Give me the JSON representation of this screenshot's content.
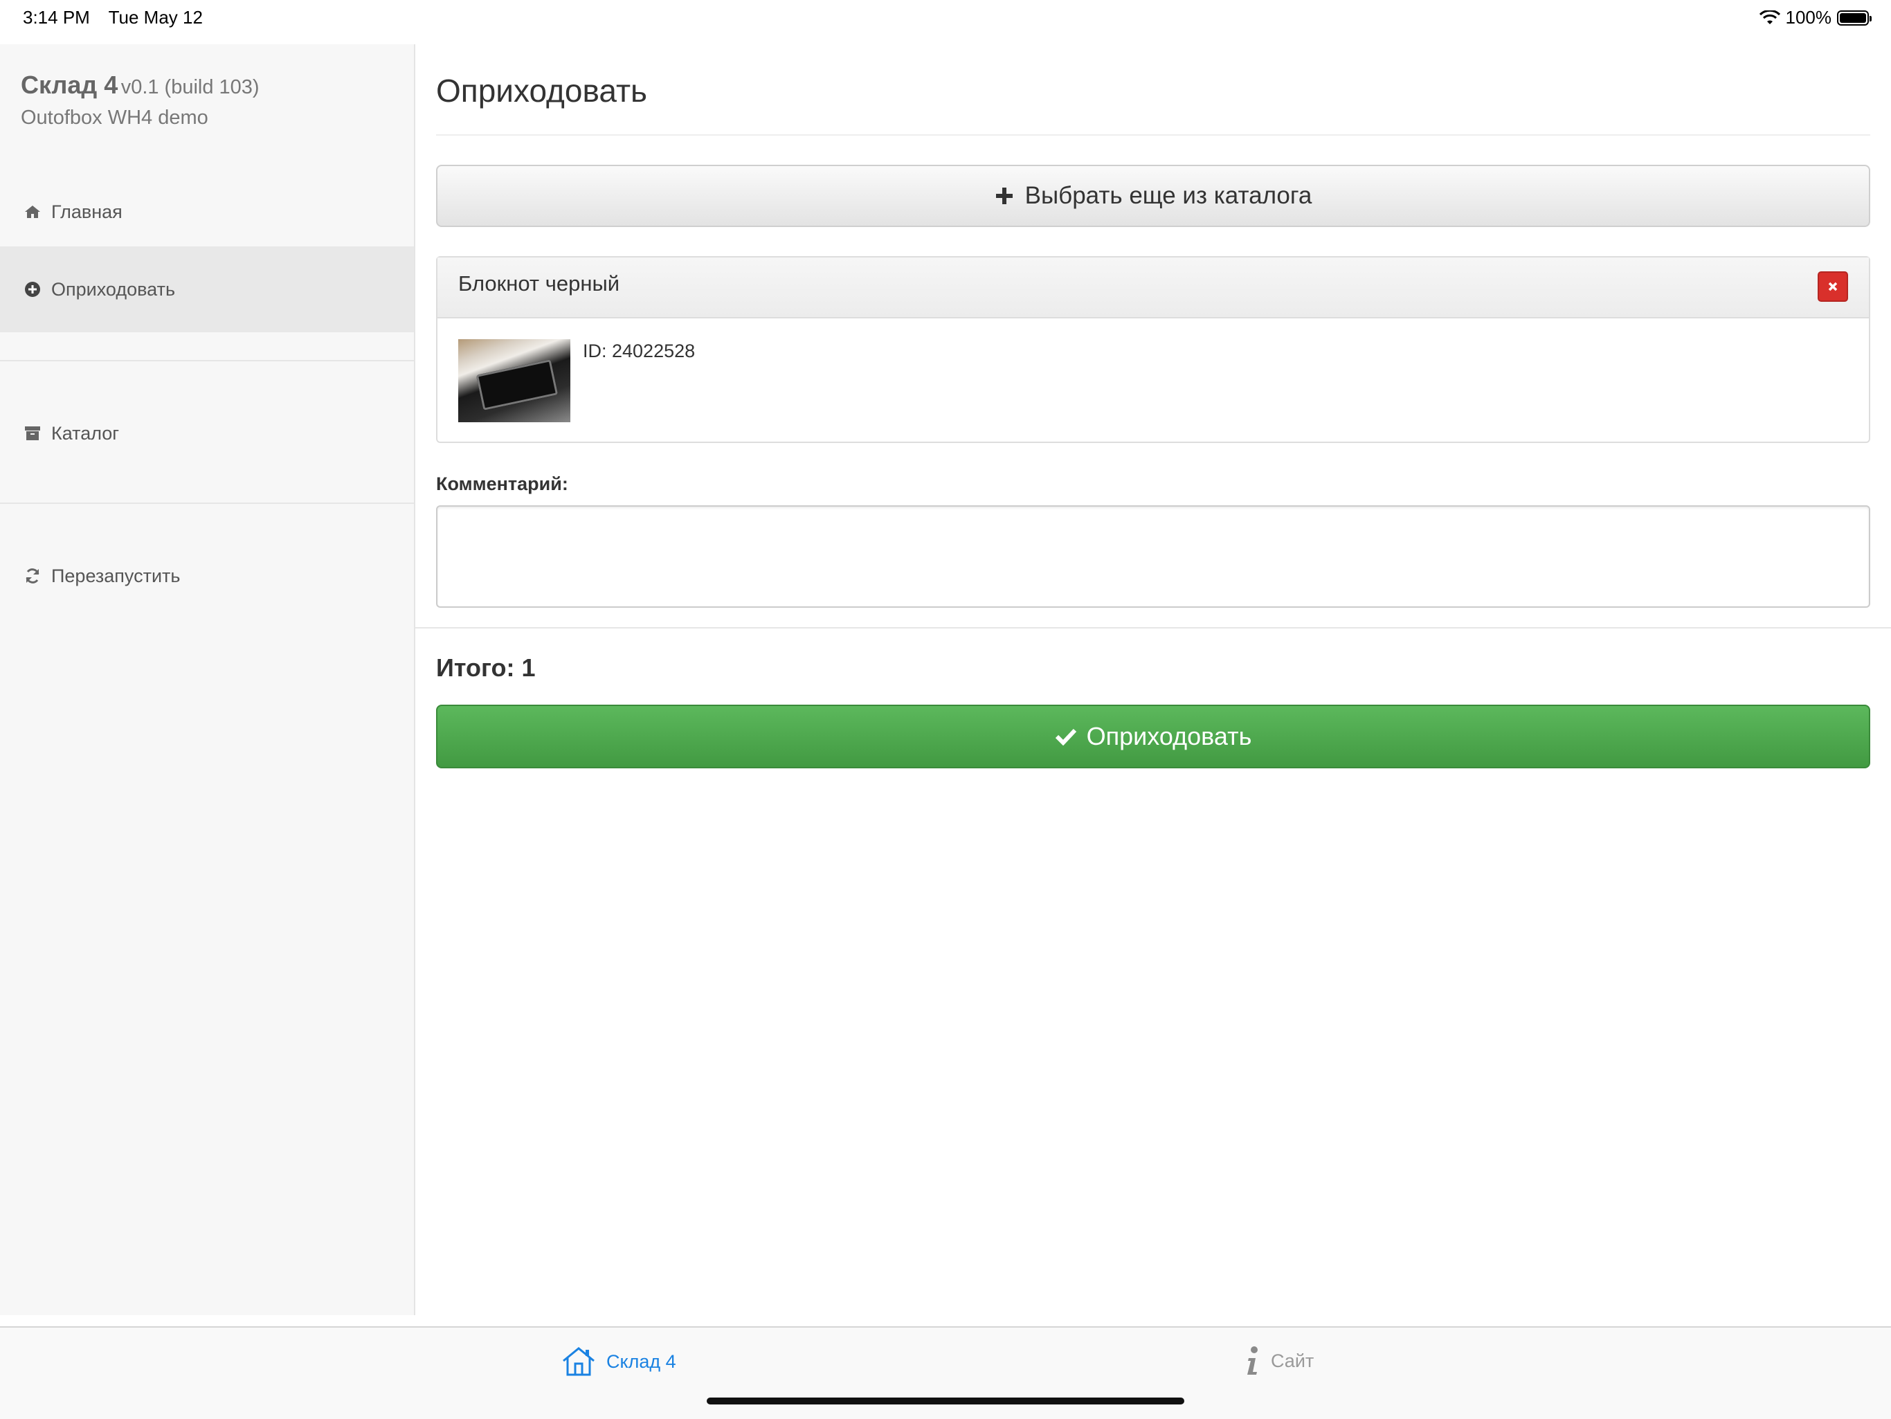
{
  "status_bar": {
    "time": "3:14 PM",
    "date": "Tue May 12",
    "battery": "100%"
  },
  "sidebar": {
    "brand_title": "Склад 4",
    "brand_version": "v0.1 (build 103)",
    "brand_subtitle": "Outofbox WH4 demo",
    "items": [
      {
        "label": "Главная",
        "icon": "home-icon"
      },
      {
        "label": "Оприходовать",
        "icon": "plus-circle-icon",
        "active": true
      },
      {
        "label": "Каталог",
        "icon": "archive-icon"
      },
      {
        "label": "Перезапустить",
        "icon": "refresh-icon"
      }
    ]
  },
  "main": {
    "title": "Оприходовать",
    "catalog_button": "Выбрать еще из каталога",
    "item": {
      "name": "Блокнот черный",
      "id_text": "ID: 24022528",
      "delete_label": "×"
    },
    "comment_label": "Комментарий:",
    "comment_value": "",
    "total": "Итого: 1",
    "submit_button": "Оприходовать"
  },
  "tabbar": {
    "tabs": [
      {
        "label": "Склад 4",
        "icon": "house-icon",
        "active": true
      },
      {
        "label": "Сайт",
        "icon": "info-icon",
        "active": false
      }
    ]
  },
  "colors": {
    "accent": "#1a82e2",
    "success": "#5cb85c",
    "danger": "#d9302b"
  }
}
